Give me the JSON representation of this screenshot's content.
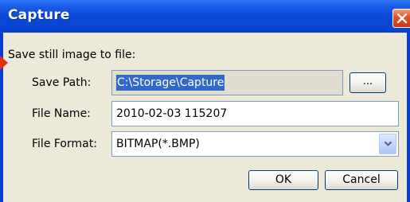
{
  "window": {
    "title": "Capture"
  },
  "dialog": {
    "heading": "Save still image to file:",
    "save_path_label": "Save Path:",
    "save_path_value": "C:\\Storage\\Capture",
    "browse_label": "...",
    "file_name_label": "File Name:",
    "file_name_value": "2010-02-03 115207",
    "file_format_label": "File Format:",
    "file_format_selected": "BITMAP(*.BMP)",
    "ok_label": "OK",
    "cancel_label": "Cancel"
  },
  "icons": {
    "close": "close-icon",
    "dropdown": "chevron-down-icon"
  },
  "colors": {
    "titlebar": "#0a4ad8",
    "close_button": "#e2562c",
    "window_bg": "#ece9d8",
    "selection": "#316ac5"
  }
}
